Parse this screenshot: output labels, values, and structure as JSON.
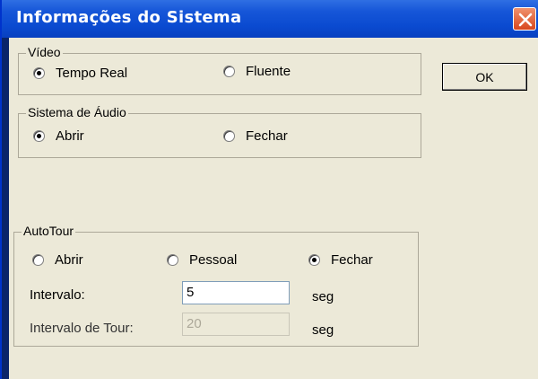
{
  "window": {
    "title": "Informações do Sistema"
  },
  "ok_label": "OK",
  "video": {
    "legend": "Vídeo",
    "options": [
      {
        "label": "Tempo Real",
        "checked": true
      },
      {
        "label": "Fluente",
        "checked": false
      }
    ]
  },
  "audio": {
    "legend": "Sistema de Áudio",
    "options": [
      {
        "label": "Abrir",
        "checked": true
      },
      {
        "label": "Fechar",
        "checked": false
      }
    ]
  },
  "autotour": {
    "legend": "AutoTour",
    "options": [
      {
        "label": "Abrir",
        "checked": false
      },
      {
        "label": "Pessoal",
        "checked": false
      },
      {
        "label": "Fechar",
        "checked": true
      }
    ],
    "interval": {
      "label": "Intervalo:",
      "value": "5",
      "unit": "seg"
    },
    "tour_interval": {
      "label": "Intervalo de Tour:",
      "value": "20",
      "unit": "seg",
      "disabled": true
    }
  },
  "colors": {
    "titlebar": "#0a4ad0",
    "dialog_bg": "#ece9d8",
    "close_button": "#d8471e"
  }
}
